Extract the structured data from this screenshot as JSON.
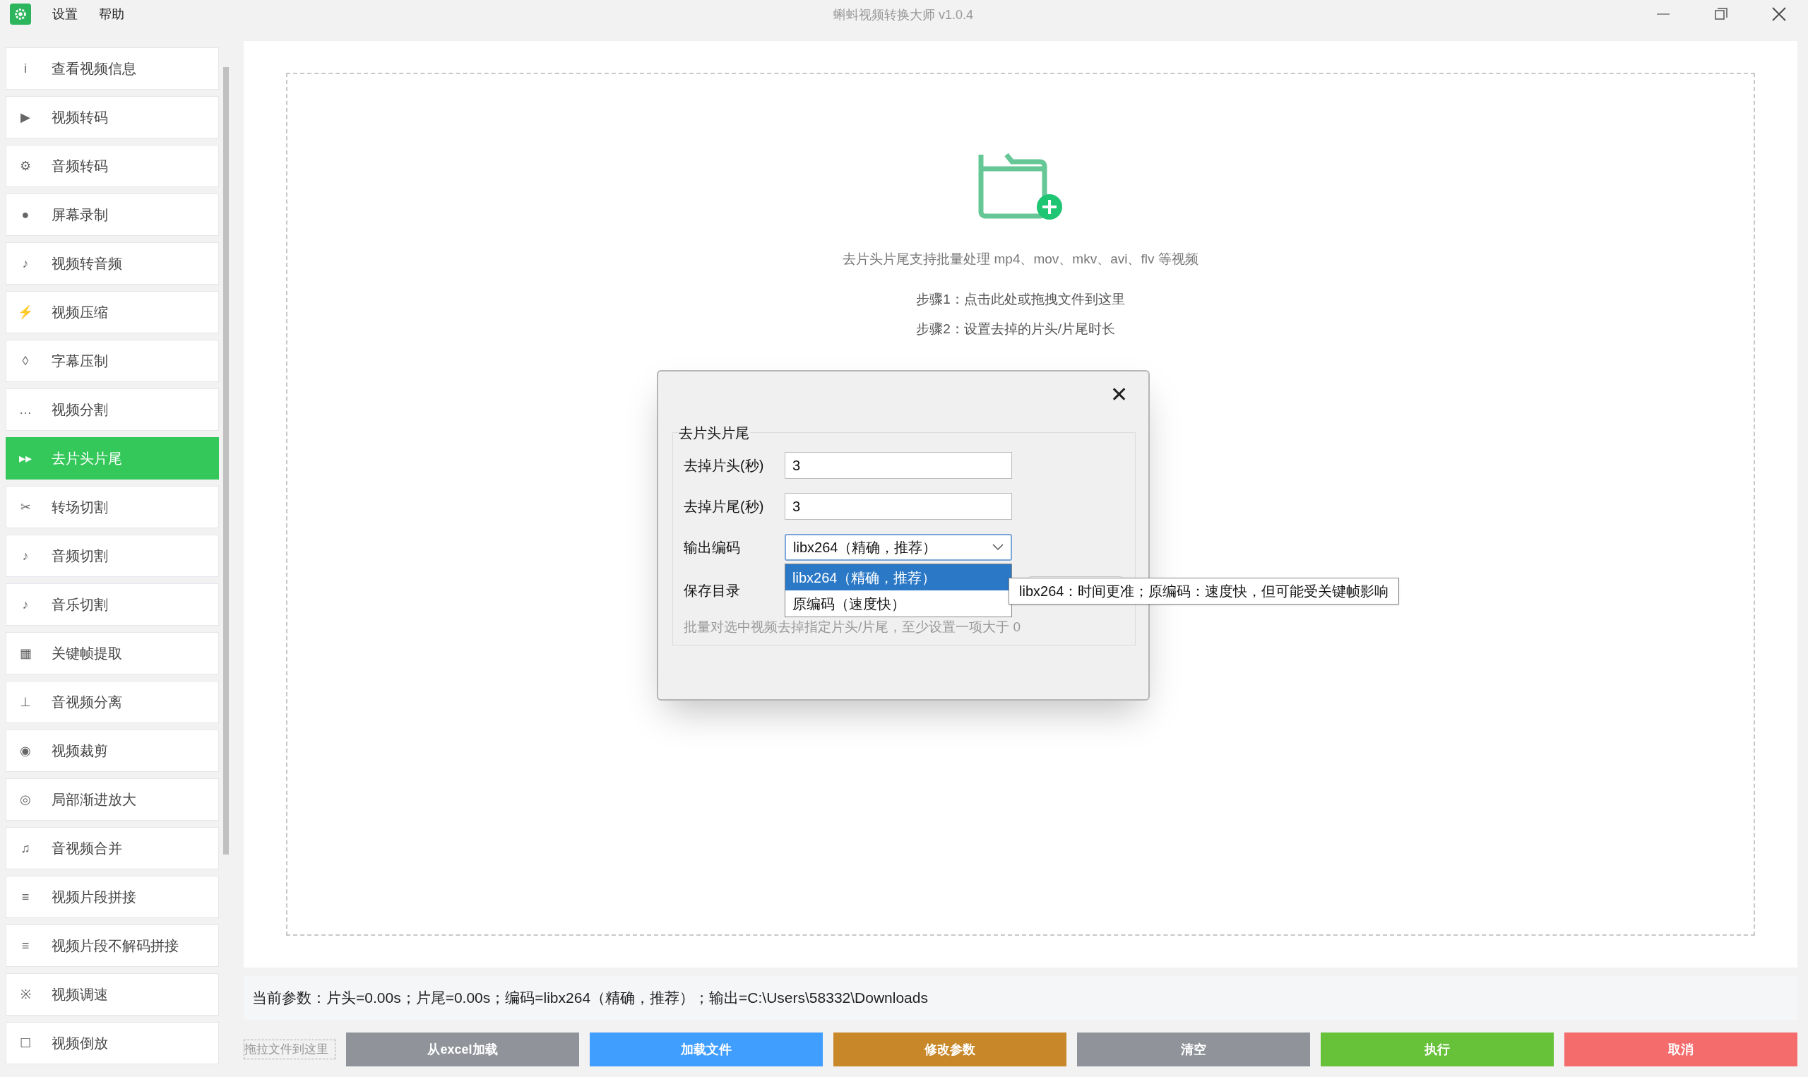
{
  "window": {
    "title": "蝌蚪视频转换大师 v1.0.4"
  },
  "menu": [
    "设置",
    "帮助"
  ],
  "sidebar": {
    "items": [
      {
        "icon": "i",
        "label": "查看视频信息",
        "selected": false
      },
      {
        "icon": "▶",
        "label": "视频转码",
        "selected": false
      },
      {
        "icon": "⚙",
        "label": "音频转码",
        "selected": false
      },
      {
        "icon": "●",
        "label": "屏幕录制",
        "selected": false
      },
      {
        "icon": "♪",
        "label": "视频转音频",
        "selected": false
      },
      {
        "icon": "⚡",
        "label": "视频压缩",
        "selected": false
      },
      {
        "icon": "◊",
        "label": "字幕压制",
        "selected": false
      },
      {
        "icon": "…",
        "label": "视频分割",
        "selected": false
      },
      {
        "icon": "▸▸",
        "label": "去片头片尾",
        "selected": true
      },
      {
        "icon": "✂",
        "label": "转场切割",
        "selected": false
      },
      {
        "icon": "♪",
        "label": "音频切割",
        "selected": false
      },
      {
        "icon": "♪",
        "label": "音乐切割",
        "selected": false
      },
      {
        "icon": "▦",
        "label": "关键帧提取",
        "selected": false
      },
      {
        "icon": "⊥",
        "label": "音视频分离",
        "selected": false
      },
      {
        "icon": "◉",
        "label": "视频裁剪",
        "selected": false
      },
      {
        "icon": "◎",
        "label": "局部渐进放大",
        "selected": false
      },
      {
        "icon": "♫",
        "label": "音视频合并",
        "selected": false
      },
      {
        "icon": "≡",
        "label": "视频片段拼接",
        "selected": false
      },
      {
        "icon": "≡",
        "label": "视频片段不解码拼接",
        "selected": false
      },
      {
        "icon": "※",
        "label": "视频调速",
        "selected": false
      },
      {
        "icon": "☐",
        "label": "视频倒放",
        "selected": false
      }
    ]
  },
  "drop_zone": {
    "description": "去片头片尾支持批量处理 mp4、mov、mkv、avi、flv 等视频",
    "steps": [
      "步骤1：点击此处或拖拽文件到这里",
      "步骤2：设置去掉的片头/片尾时长"
    ]
  },
  "status": "当前参数：片头=0.00s；片尾=0.00s；编码=libx264（精确，推荐）；输出=C:\\Users\\58332\\Downloads",
  "drag_hint": "拖拉文件到这里",
  "buttons": [
    {
      "label": "从excel加载",
      "color": "#909399"
    },
    {
      "label": "加载文件",
      "color": "#409eff"
    },
    {
      "label": "修改参数",
      "color": "#c8882a"
    },
    {
      "label": "清空",
      "color": "#909399"
    },
    {
      "label": "执行",
      "color": "#67c23a"
    },
    {
      "label": "取消",
      "color": "#f56c6c"
    }
  ],
  "dialog": {
    "close": "✕",
    "group_title": "去片头片尾",
    "fields": [
      {
        "label": "去掉片头(秒)",
        "value": "3"
      },
      {
        "label": "去掉片尾(秒)",
        "value": "3"
      }
    ],
    "codec": {
      "label": "输出编码",
      "value": "libx264（精确，推荐）",
      "options": [
        {
          "label": "libx264（精确，推荐）",
          "selected": true
        },
        {
          "label": "原编码（速度快）",
          "selected": false
        }
      ]
    },
    "save_dir_label": "保存目录",
    "hint": "批量对选中视频去掉指定片头/片尾，至少设置一项大于 0",
    "tooltip": "libx264：时间更准；原编码：速度快，但可能受关键帧影响"
  }
}
